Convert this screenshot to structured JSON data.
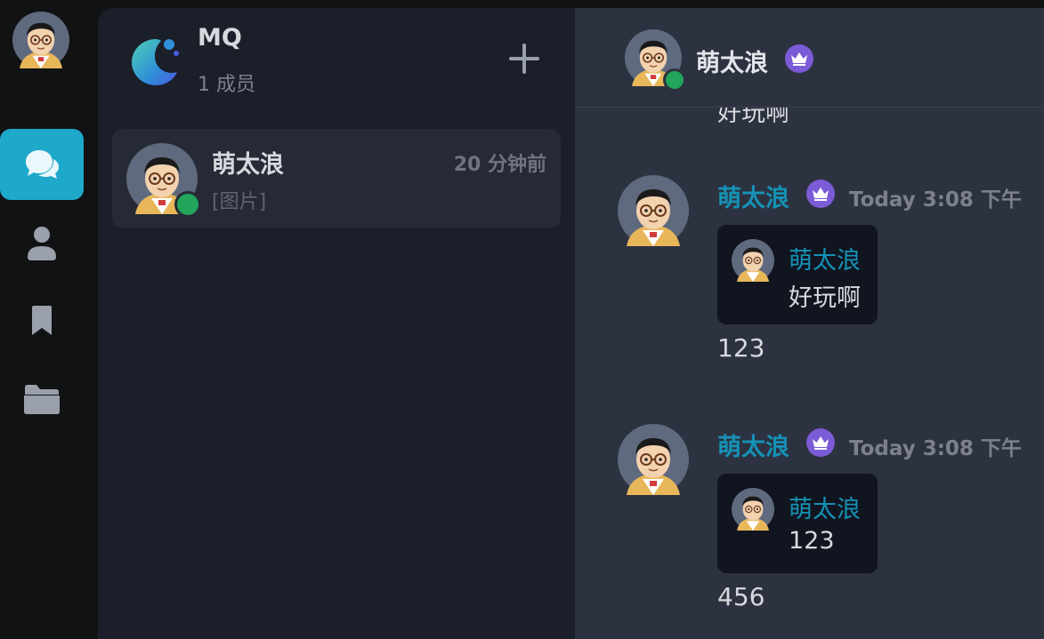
{
  "rail": {
    "items": [
      {
        "icon": "chat-icon",
        "active": true
      },
      {
        "icon": "user-icon",
        "active": false
      },
      {
        "icon": "bookmark-icon",
        "active": false
      },
      {
        "icon": "folder-icon",
        "active": false
      }
    ]
  },
  "group": {
    "name": "MQ",
    "members": "1 成员"
  },
  "conversations": [
    {
      "name": "萌太浪",
      "time": "20 分钟前",
      "preview": "[图片]"
    }
  ],
  "chat": {
    "header_name": "萌太浪",
    "clipped_text": "好玩啊",
    "messages": [
      {
        "author": "萌太浪",
        "time": "Today 3:08 下午",
        "quote_author": "萌太浪",
        "quote_text": "好玩啊",
        "body": "123"
      },
      {
        "author": "萌太浪",
        "time": "Today 3:08 下午",
        "quote_author": "萌太浪",
        "quote_text": "123",
        "body": "456"
      }
    ]
  },
  "colors": {
    "accent": "#1ea8c9",
    "author": "#1592b5",
    "online": "#22a45a",
    "crown_badge": "#7b5bd6"
  }
}
